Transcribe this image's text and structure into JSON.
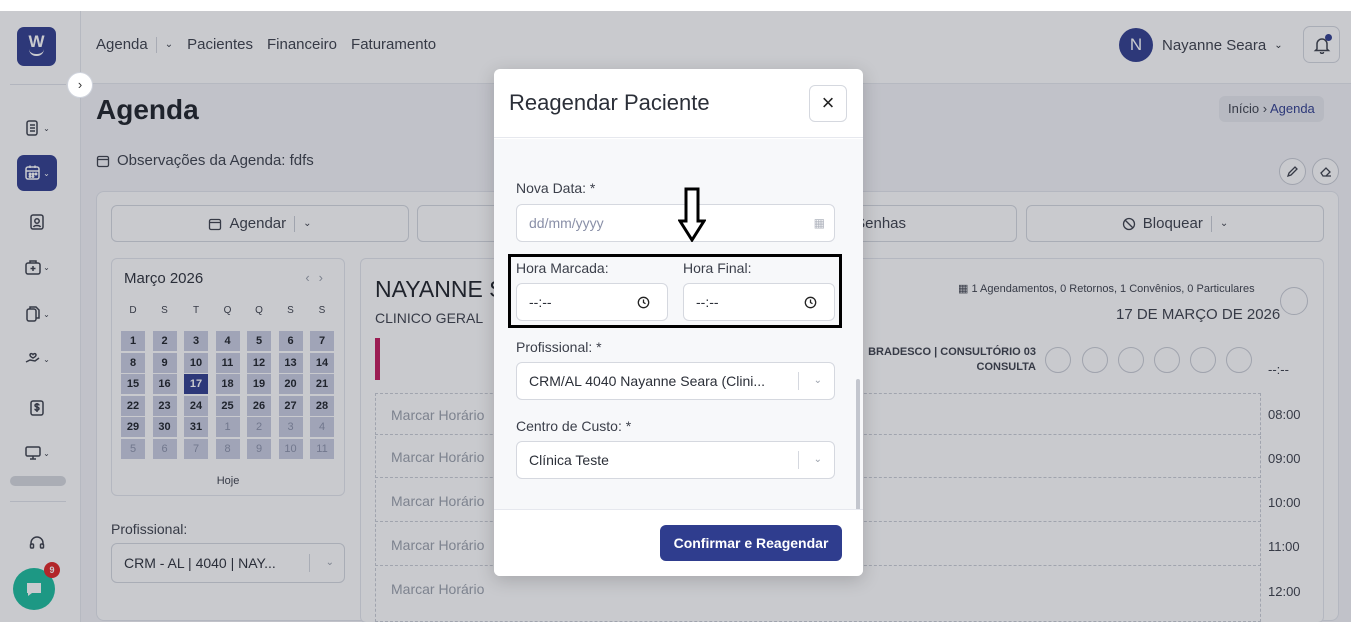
{
  "header": {
    "nav": [
      "Agenda",
      "Pacientes",
      "Financeiro",
      "Faturamento"
    ],
    "user_initial": "N",
    "user_name": "Nayanne Seara"
  },
  "sidebar": {
    "logo": "W",
    "chat_badge": "9"
  },
  "page": {
    "title": "Agenda",
    "breadcrumb_home": "Início",
    "breadcrumb_current": "Agenda",
    "observations": "Observações da Agenda: fdfs"
  },
  "toolbar": {
    "agendar": "Agendar",
    "senhas": "Senhas",
    "bloquear": "Bloquear"
  },
  "calendar": {
    "title": "Março  2026",
    "weekdays": [
      "D",
      "S",
      "T",
      "Q",
      "Q",
      "S",
      "S"
    ],
    "days": [
      "1",
      "2",
      "3",
      "4",
      "5",
      "6",
      "7",
      "8",
      "9",
      "10",
      "11",
      "12",
      "13",
      "14",
      "15",
      "16",
      "17",
      "18",
      "19",
      "20",
      "21",
      "22",
      "23",
      "24",
      "25",
      "26",
      "27",
      "28",
      "29",
      "30",
      "31",
      "1",
      "2",
      "3",
      "4",
      "5",
      "6",
      "7",
      "8",
      "9",
      "10",
      "11"
    ],
    "today_label": "Hoje"
  },
  "filter": {
    "profissional_label": "Profissional:",
    "profissional_value": "CRM - AL | 4040 | NAY..."
  },
  "schedule": {
    "doctor_name": "NAYANNE S",
    "specialty": "CLINICO GERAL",
    "summary": "1 Agendamentos, 0 Retornos, 1 Convênios, 0 Particulares",
    "date": "17 DE MARÇO DE 2026",
    "convenio_line1": "BRADESCO | CONSULTÓRIO 03",
    "convenio_line2": "CONSULTA",
    "header_time": "--:--",
    "slot_label": "Marcar Horário",
    "times": [
      "08:00",
      "09:00",
      "10:00",
      "11:00",
      "12:00"
    ]
  },
  "modal": {
    "title": "Reagendar Paciente",
    "nova_data_label": "Nova Data: *",
    "nova_data_placeholder": "dd/mm/yyyy",
    "hora_marcada_label": "Hora Marcada:",
    "hora_marcada_value": "--:--",
    "hora_final_label": "Hora Final:",
    "hora_final_value": "--:--",
    "profissional_label": "Profissional: *",
    "profissional_value": "CRM/AL 4040 Nayanne Seara (Clini...",
    "centro_label": "Centro de Custo: *",
    "centro_value": "Clínica Teste",
    "confirm_label": "Confirmar e Reagendar"
  },
  "colors": {
    "primary": "#2f3d8e",
    "accent_bar": "#c2185b",
    "chat": "#1abc9c",
    "badge": "#e02424"
  }
}
